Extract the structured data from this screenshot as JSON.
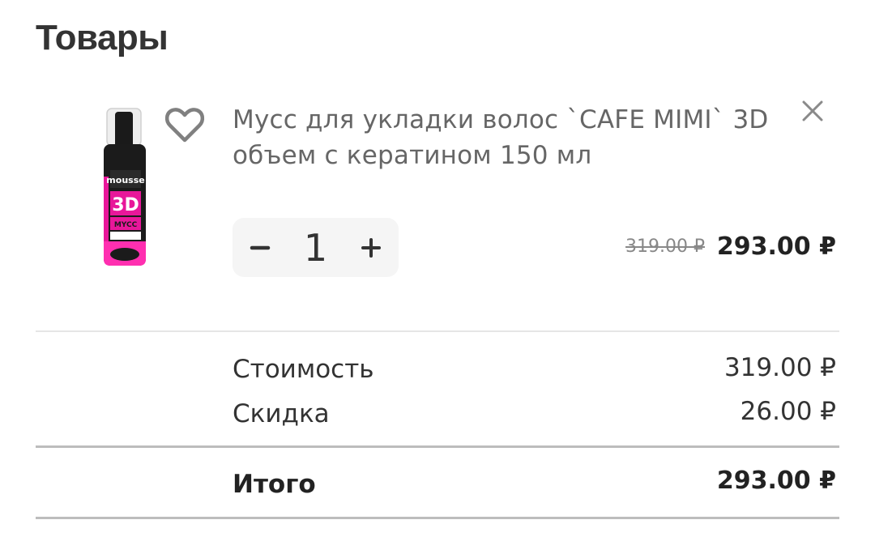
{
  "section": {
    "title": "Товары"
  },
  "product": {
    "name": "Мусс для укладки волос `CAFE MIMI` 3D объем с кератином 150 мл",
    "image_label": "mousse 3D",
    "quantity": "1",
    "minus_label": "−",
    "plus_label": "+",
    "old_price": "319.00 ₽",
    "price": "293.00 ₽"
  },
  "summary": {
    "cost_label": "Стоимость",
    "cost_value": "319.00 ₽",
    "discount_label": "Скидка",
    "discount_value": "26.00 ₽",
    "total_label": "Итого",
    "total_value": "293.00 ₽"
  },
  "icons": {
    "favorite": "heart-outline-icon",
    "remove": "close-icon",
    "minus": "minus-icon",
    "plus": "plus-icon"
  },
  "colors": {
    "text_dark": "#222222",
    "text_muted": "#666666",
    "stepper_bg": "#f5f5f5",
    "product_accent": "#e8179a"
  }
}
